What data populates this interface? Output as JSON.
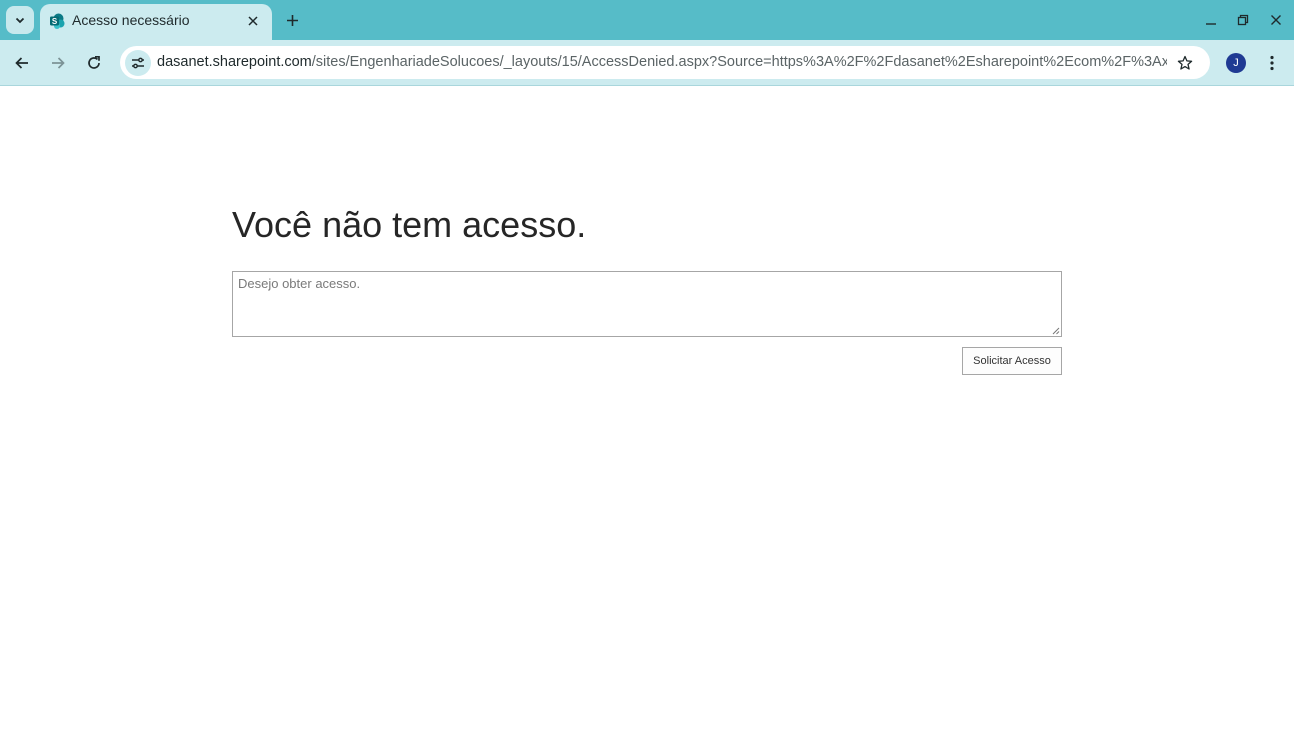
{
  "browser": {
    "tab": {
      "title": "Acesso necessário",
      "favicon": "sharepoint-icon"
    },
    "address": {
      "host": "dasanet.sharepoint.com",
      "path": "/sites/EngenhariadeSolucoes/_layouts/15/AccessDenied.aspx?Source=https%3A%2F%2Fdasanet%2Esharepoint%2Ecom%2F%3Ax%..."
    },
    "profile_initial": "J",
    "colors": {
      "titlebar": "#56bcc8",
      "toolbar": "#ccebef",
      "avatar": "#1f3a93"
    },
    "icons": [
      "chevron-down-icon",
      "close-icon",
      "plus-icon",
      "minimize-icon",
      "restore-icon",
      "back-icon",
      "forward-icon",
      "reload-icon",
      "tune-icon",
      "star-icon",
      "kebab-icon"
    ]
  },
  "page": {
    "title": "Você não tem acesso.",
    "request_placeholder": "Desejo obter acesso.",
    "request_button": "Solicitar Acesso"
  }
}
